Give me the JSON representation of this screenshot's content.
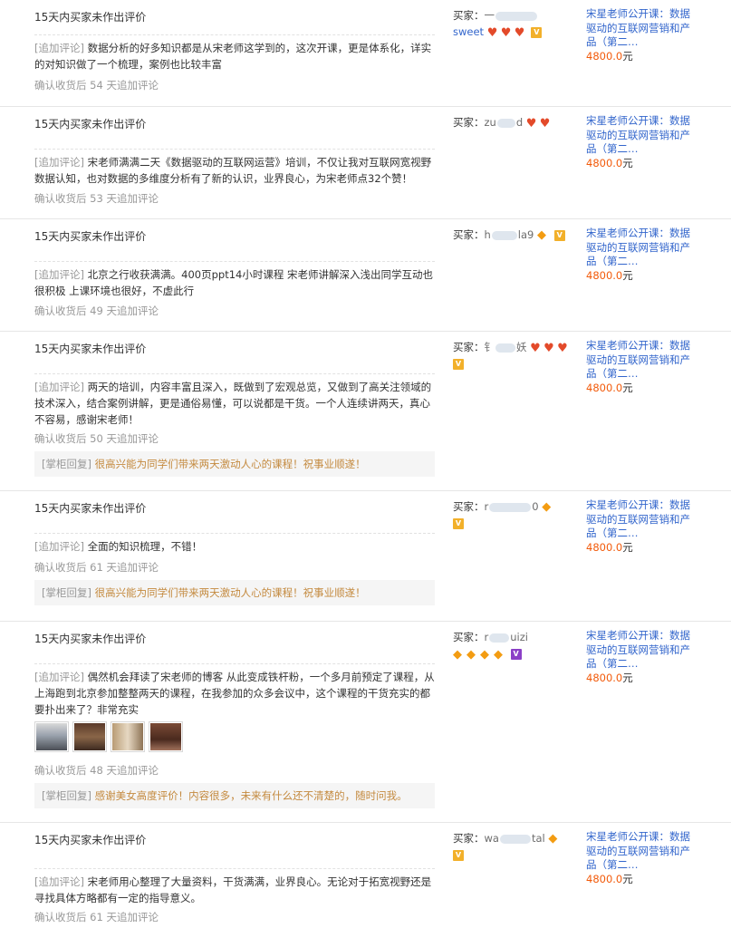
{
  "colors": {
    "link": "#3366cc",
    "price": "#f25a0a",
    "reply": "#c48a3f",
    "muted": "#999999",
    "heart": "#e34a2a",
    "diamond": "#f39c12"
  },
  "common": {
    "head": "15天内买家未作出评价",
    "append_tag": "[追加评论]",
    "reply_tag": "[掌柜回复]",
    "buyer_label": "买家：",
    "product_name_l1": "宋星老师公开课：数据",
    "product_name_l2": "驱动的互联网营销和产",
    "product_name_l3": "品（第二…",
    "price": "4800.0",
    "price_unit": "元"
  },
  "reviews": [
    {
      "append": "数据分析的好多知识都是从宋老师这学到的，这次开课，更是体系化，详实的对知识做了一个梳理，案例也比较丰富",
      "after": "确认收货后 54 天追加评论",
      "buyer_a": "一",
      "buyer_b": "sweet",
      "badges": "hearts3",
      "vip": "gold"
    },
    {
      "append": "宋老师满满二天《数据驱动的互联网运营》培训，不仅让我对互联网宽视野数据认知，也对数据的多维度分析有了新的认识，业界良心，为宋老师点32个赞！",
      "after": "确认收货后 53 天追加评论",
      "buyer_a": "zu",
      "buyer_b": "d",
      "badges": "hearts2",
      "vip": ""
    },
    {
      "append": "北京之行收获满满。400页ppt14小时课程 宋老师讲解深入浅出同学互动也很积极 上课环境也很好，不虚此行",
      "after": "确认收货后 49 天追加评论",
      "buyer_a": "h",
      "buyer_b": "la9",
      "badges": "diamond1",
      "vip": "gold"
    },
    {
      "append": "两天的培训，内容丰富且深入，既做到了宏观总览，又做到了高关注领域的技术深入，结合案例讲解，更是通俗易懂，可以说都是干货。一个人连续讲两天，真心不容易，感谢宋老师！",
      "after": "确认收货后 50 天追加评论",
      "reply": "很高兴能为同学们带来两天激动人心的课程！祝事业顺遂！",
      "buyer_a": "钅",
      "buyer_b": "妖",
      "badges": "hearts3",
      "vip": "gold"
    },
    {
      "append": "全面的知识梳理，不错！",
      "after": "确认收货后 61 天追加评论",
      "reply": "很高兴能为同学们带来两天激动人心的课程！祝事业顺遂！",
      "buyer_a": "r",
      "buyer_b": "0",
      "badges": "diamond1",
      "vip": "gold"
    },
    {
      "append": "偶然机会拜读了宋老师的博客 从此变成铁杆粉，一个多月前预定了课程，从上海跑到北京参加整整两天的课程，在我参加的众多会议中，这个课程的干货充实的都要扑出来了？非常充实",
      "after": "确认收货后 48 天追加评论",
      "reply": "感谢美女高度评价！内容很多，未来有什么还不清楚的，随时问我。",
      "buyer_a": "r",
      "buyer_b": "uizi",
      "badges": "diamond4",
      "vip": "purple"
    },
    {
      "append": "宋老师用心整理了大量资料，干货满满，业界良心。无论对于拓宽视野还是寻找具体方略都有一定的指导意义。",
      "after": "确认收货后 61 天追加评论",
      "buyer_a": "wa",
      "buyer_b": "tal",
      "badges": "diamond1",
      "vip": "gold"
    }
  ]
}
